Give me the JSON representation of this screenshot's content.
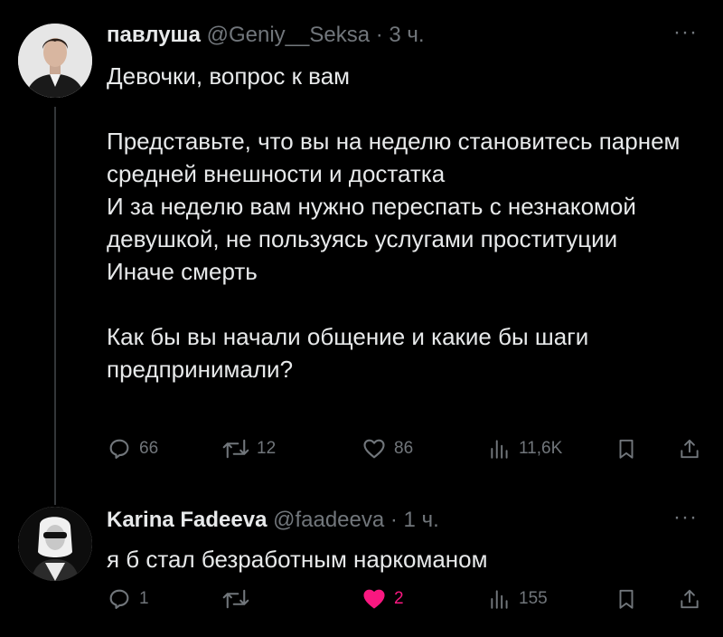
{
  "tweet": {
    "author_name": "павлуша",
    "handle": "@Geniy__Seksa",
    "time": "3 ч.",
    "text": "Девочки, вопрос к вам\n\nПредставьте, что вы на неделю становитесь парнем средней внешности и достатка\nИ за неделю вам нужно переспать с незнакомой девушкой, не пользуясь услугами проституции\nИначе смерть\n\nКак бы вы начали общение и какие бы шаги предпринимали?",
    "replies": "66",
    "reposts": "12",
    "likes": "86",
    "views": "11,6K"
  },
  "reply": {
    "author_name": "Karina Fadeeva",
    "handle": "@faadeeva",
    "time": "1 ч.",
    "text": "я б стал безработным наркоманом",
    "replies": "1",
    "reposts": "",
    "likes": "2",
    "views": "155"
  },
  "icons": [
    "reply-icon",
    "repost-icon",
    "like-icon",
    "views-icon",
    "bookmark-icon",
    "share-icon",
    "more-icon"
  ],
  "colors": {
    "background": "#000000",
    "text": "#e7e9ea",
    "muted": "#71767b",
    "like_active": "#f91880"
  }
}
